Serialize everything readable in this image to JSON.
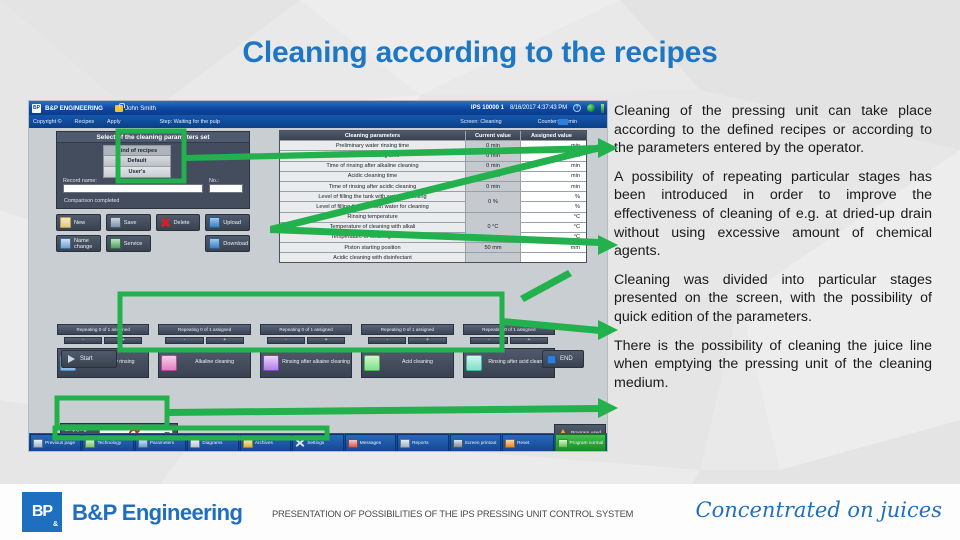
{
  "slide": {
    "title": "Cleaning according to the recipes",
    "accent_color": "#1f77c4",
    "background_color": "#e8e8e8"
  },
  "body_text": {
    "paragraphs": [
      "Cleaning of the pressing unit can take place according to the defined recipes or according to the parameters entered by the operator.",
      "A possibility of repeating particular stages has been introduced in order to improve the effectiveness of cleaning of e.g. at dried-up drain without using excessive amount of chemical agents.",
      "Cleaning was divided into particular stages presented on the screen, with the possibility of quick edition of the parameters.",
      "There is the possibility of cleaning the juice line when emptying the pressing unit of the cleaning medium."
    ]
  },
  "hmi": {
    "titlebar": {
      "logo": "BP",
      "company": "B&P ENGINEERING",
      "user": "John Smith",
      "machine": "IPS 10000 1",
      "datetime": "8/16/2017 4:37:43 PM",
      "help_icon": "?",
      "globe_icon": "globe-icon"
    },
    "subbar": {
      "copyright": "Copyright ©",
      "recipes": "Recipes",
      "apply": "Apply",
      "step": "Step:  Waiting for the pulp",
      "screen": "Screen: Cleaning",
      "counter_label": "Counter:",
      "counter_value": "",
      "counter_unit": "min"
    },
    "recipe_panel": {
      "header": "Select of the cleaning parameters set",
      "kind_header": "Kind of recipes",
      "kind_options": [
        "Default",
        "User's"
      ],
      "record_label": "Record name:",
      "record_value": "",
      "no_label": "No.:",
      "no_value": "",
      "status": "Comparison completed"
    },
    "buttons": [
      {
        "label": "New",
        "icon": "new-file-icon"
      },
      {
        "label": "Save",
        "icon": "save-icon"
      },
      {
        "label": "Delete",
        "icon": "delete-x-icon"
      },
      {
        "label": "Upload",
        "icon": "upload-icon"
      },
      {
        "label": "Name change",
        "icon": "rename-icon"
      },
      {
        "label": "Service",
        "icon": "service-icon"
      },
      {
        "label": "",
        "icon": ""
      },
      {
        "label": "Download",
        "icon": "download-icon"
      }
    ],
    "table": {
      "headers": [
        "Cleaning parameters",
        "Current value",
        "Assigned value"
      ],
      "rows": [
        {
          "name": "Preliminary water rinsing time",
          "current": "0 min",
          "assigned_unit": "min"
        },
        {
          "name": "Alkaline cleaning time",
          "current": "0 min",
          "assigned_unit": "min"
        },
        {
          "name": "Time of rinsing after alkaline cleaning",
          "current": "0 min",
          "assigned_unit": "min"
        },
        {
          "name": "Acidic cleaning time",
          "current": "0 min",
          "assigned_unit": "min"
        },
        {
          "name": "Time of rinsing after acidic cleaning",
          "current": "0 min",
          "assigned_unit": "min"
        }
      ],
      "group_level": {
        "names": [
          "Level of filling the tank with water for rinsing",
          "Level of filling the tank with water for cleaning"
        ],
        "current": "0 %",
        "assigned_units": [
          "%",
          "%"
        ]
      },
      "group_temp": {
        "names": [
          "Rinsing temperature",
          "Temperature of cleaning with alkali",
          "Temperature of cleaning with acid"
        ],
        "current": "0 °C",
        "assigned_units": [
          "°C",
          "°C",
          "°C"
        ]
      },
      "row_piston": {
        "name": "Piston starting position",
        "current": "50 mm",
        "assigned_unit": "mm"
      },
      "row_disinfect": {
        "name": "Acidic cleaning with disinfectant",
        "current": "",
        "assigned_unit": ""
      }
    },
    "stages": {
      "repeat_label": "Repeating 0\nof 1 assigned",
      "repeat_minus": "-",
      "repeat_plus": "+",
      "items": [
        {
          "label": "Preliminary rinsing",
          "icon": "water-drop-icon"
        },
        {
          "label": "Alkaline cleaning",
          "icon": "flask-pink-icon"
        },
        {
          "label": "Rinsing after alkaine cleaning",
          "icon": "droplet-purple-icon"
        },
        {
          "label": "Acid cleaning",
          "icon": "flask-green-icon"
        },
        {
          "label": "Rinsing after acid cleaning",
          "icon": "droplet-teal-icon"
        }
      ]
    },
    "start_button": "Start",
    "end_button": "END",
    "empty_tank": {
      "label": "Emptying the tank by:",
      "value_icon": "no-entry-icon"
    },
    "program_used": "Program used",
    "navbar": [
      {
        "label": "Previous page",
        "icon": "previous-page-icon"
      },
      {
        "label": "Technology",
        "icon": "technology-icon"
      },
      {
        "label": "Parameters",
        "icon": "parameters-icon"
      },
      {
        "label": "Diagrams",
        "icon": "diagrams-icon"
      },
      {
        "label": "Archives",
        "icon": "archives-icon"
      },
      {
        "label": "Settings",
        "icon": "settings-icon"
      },
      {
        "label": "Messages",
        "icon": "messages-icon"
      },
      {
        "label": "Reports",
        "icon": "reports-icon"
      },
      {
        "label": "Screen printout",
        "icon": "printer-icon"
      },
      {
        "label": "Reset",
        "icon": "reset-warning-icon"
      },
      {
        "label": "Program normal",
        "icon": "program-normal-icon"
      }
    ]
  },
  "footer": {
    "logo_main": "BP",
    "logo_sub": "&",
    "company": "B&P Engineering",
    "tagline": "PRESENTATION OF POSSIBILITIES OF THE IPS PRESSING UNIT CONTROL SYSTEM",
    "slogan": "Concentrated on juices"
  }
}
